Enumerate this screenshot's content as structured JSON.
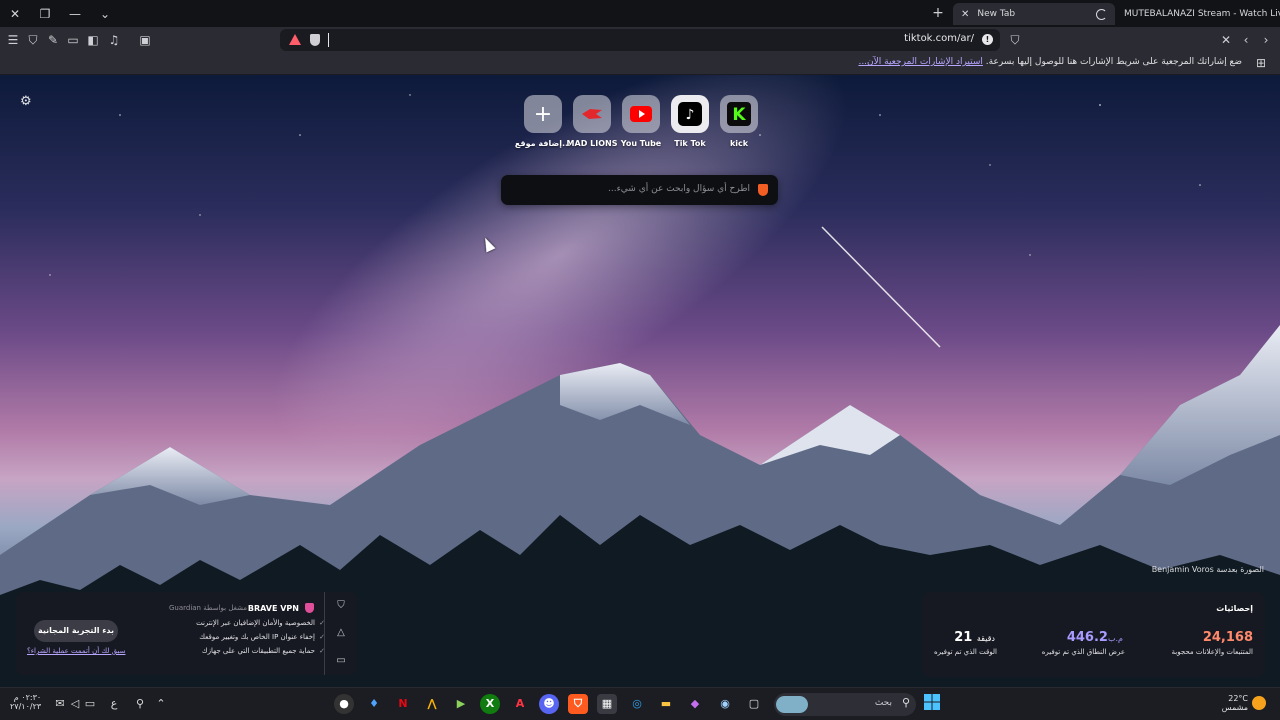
{
  "titlebar": {
    "window_controls": [
      "close-icon",
      "restore-icon",
      "minimize-icon",
      "chevron-down-icon"
    ],
    "tabs": [
      {
        "label": "New Tab",
        "active": true
      },
      {
        "label": "MUTEBALANAZI Stream - Watch Live",
        "active": false
      }
    ]
  },
  "toolbar": {
    "url": "tiktok.com/ar/",
    "left_icons": [
      "menu-icon",
      "shield-icon",
      "pin-icon",
      "tabs-icon",
      "sidebar-icon",
      "music-icon",
      "wallet-icon"
    ]
  },
  "bookmarks_bar": {
    "text": "ضع إشاراتك المرجعية على شريط الإشارات هنا للوصول إليها بسرعة.",
    "link": "استيراد الإشارات المرجعية الآن..."
  },
  "tiles": [
    {
      "label": "إضافة موقع...",
      "icon": "plus-icon"
    },
    {
      "label": "MAD LIONS",
      "icon": "mad-lions-icon"
    },
    {
      "label": "You Tube",
      "icon": "youtube-icon"
    },
    {
      "label": "Tik Tok",
      "icon": "tiktok-icon"
    },
    {
      "label": "kick",
      "icon": "kick-icon"
    }
  ],
  "search": {
    "placeholder": "اطرح أي سؤال وابحث عن أي شيء..."
  },
  "photo_credit": "الصورة بعدسة Benjamin Voros",
  "vpn": {
    "title": "BRAVE VPN",
    "powered_by": "مشغل بواسطة Guardian",
    "features": [
      "الخصوصية والأمان الإضافيان عبر الإنترنت",
      "إخفاء عنوان IP الخاص بك وتغيير موقعك",
      "حماية جميع التطبيقات التي على جهازك"
    ],
    "cta": "بدء التجربة المجانية",
    "link": "سبق لك أن أتممت عملية الشراء؟"
  },
  "stats": {
    "heading": "إحصائيات",
    "items": [
      {
        "value": "24,168",
        "unit": "",
        "caption": "المتتبعات والإعلانات محجوبة",
        "color": "#ff8a6b"
      },
      {
        "value": "446.2",
        "unit": "م.ب",
        "caption": "عرض النطاق الذي تم توفيره",
        "color": "#a99bff"
      },
      {
        "value": "21",
        "unit": "دقيقة",
        "caption": "الوقت الذي تم توفيره",
        "color": "#ffffff"
      }
    ]
  },
  "taskbar": {
    "search_label": "بحث",
    "weather": {
      "temp": "22°C",
      "condition": "مشمس"
    },
    "clock": {
      "time": "٠٢:٣٠ م",
      "date": "٢٧/١٠/٢٣"
    },
    "lang": "ع"
  }
}
